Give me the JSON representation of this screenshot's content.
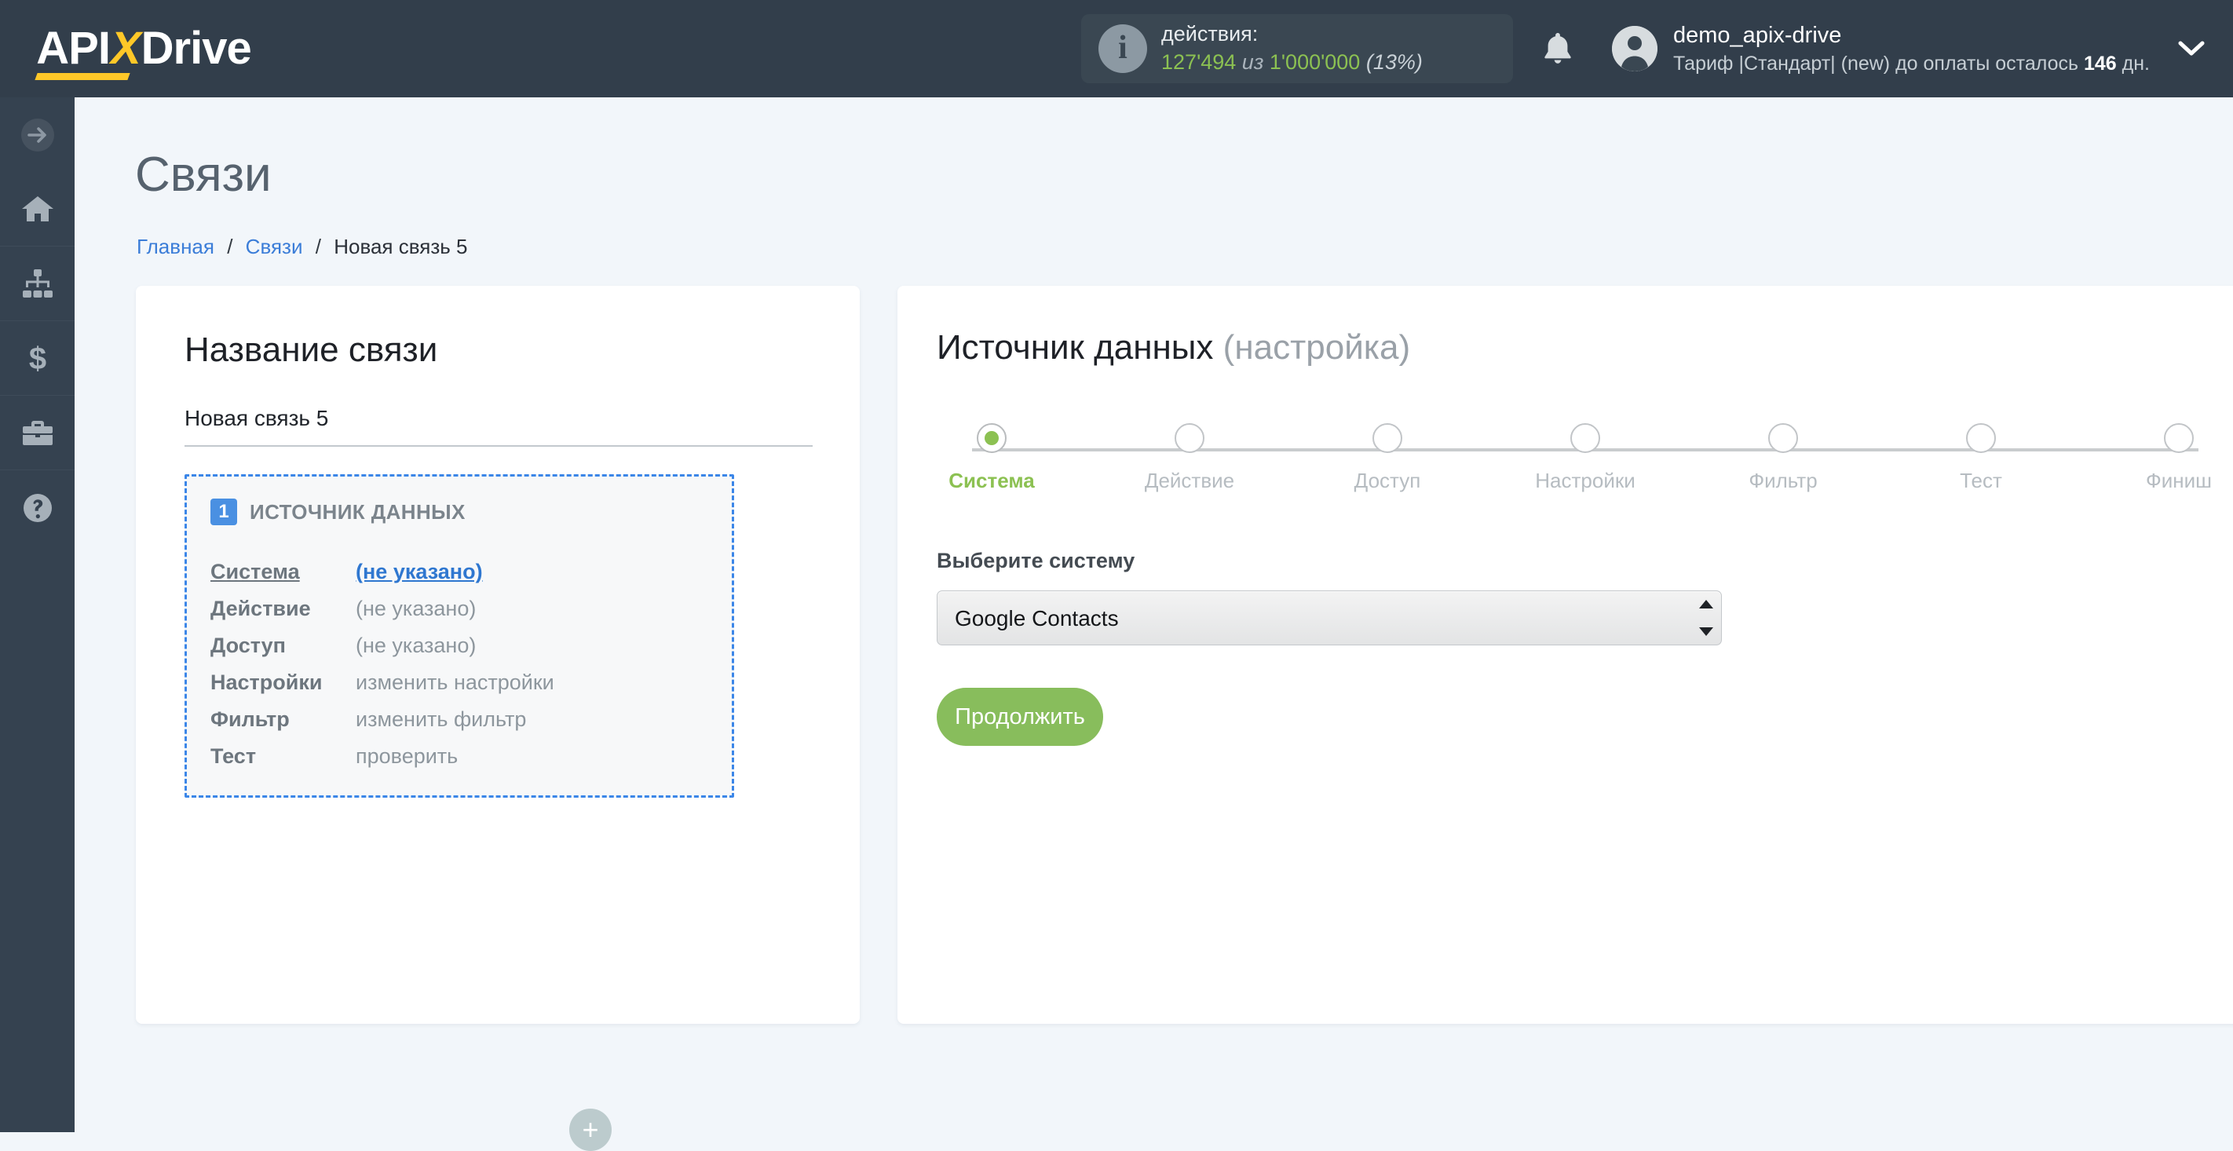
{
  "header": {
    "logo": {
      "part1": "API",
      "x": "X",
      "part2": "Drive"
    },
    "counter": {
      "icon": "info-icon",
      "label": "действия:",
      "used": "127'494",
      "separator": "из",
      "total": "1'000'000",
      "percent": "(13%)"
    },
    "notifications_icon": "bell-icon",
    "user": {
      "avatar": "user-avatar-icon",
      "name": "demo_apix-drive",
      "plan_prefix": "Тариф |Стандарт| (new) до оплаты осталось ",
      "plan_days": "146",
      "plan_suffix": " дн.",
      "chevron": "chevron-down-icon"
    }
  },
  "sidebar": {
    "items": [
      {
        "icon": "arrow-right-circle-icon",
        "name": "expand-menu"
      },
      {
        "icon": "home-icon",
        "name": "home"
      },
      {
        "icon": "sitemap-icon",
        "name": "connections"
      },
      {
        "icon": "dollar-icon",
        "name": "billing"
      },
      {
        "icon": "briefcase-icon",
        "name": "business"
      },
      {
        "icon": "question-circle-icon",
        "name": "help"
      }
    ]
  },
  "page": {
    "title": "Связи",
    "breadcrumb": {
      "items": [
        "Главная",
        "Связи",
        "Новая связь 5"
      ],
      "separator": "/"
    }
  },
  "left_card": {
    "title": "Название связи",
    "name_value": "Новая связь 5",
    "name_placeholder": "Название связи",
    "source_block": {
      "badge": "1",
      "heading": "ИСТОЧНИК ДАННЫХ",
      "rows": [
        {
          "key": "Система",
          "value": "(не указано)",
          "key_link": true,
          "value_link": true
        },
        {
          "key": "Действие",
          "value": "(не указано)",
          "key_link": false,
          "value_link": false
        },
        {
          "key": "Доступ",
          "value": "(не указано)",
          "key_link": false,
          "value_link": false
        },
        {
          "key": "Настройки",
          "value": "изменить настройки",
          "key_link": false,
          "value_link": false
        },
        {
          "key": "Фильтр",
          "value": "изменить фильтр",
          "key_link": false,
          "value_link": false
        },
        {
          "key": "Тест",
          "value": "проверить",
          "key_link": false,
          "value_link": false
        }
      ]
    },
    "add_button_label": "+"
  },
  "right_card": {
    "title_main": "Источник данных",
    "title_muted": "(настройка)",
    "steps": [
      {
        "label": "Система",
        "active": true
      },
      {
        "label": "Действие",
        "active": false
      },
      {
        "label": "Доступ",
        "active": false
      },
      {
        "label": "Настройки",
        "active": false
      },
      {
        "label": "Фильтр",
        "active": false
      },
      {
        "label": "Тест",
        "active": false
      },
      {
        "label": "Финиш",
        "active": false
      }
    ],
    "field_label": "Выберите систему",
    "system_selected": "Google Contacts",
    "system_options": [
      "Google Contacts"
    ],
    "continue_label": "Продолжить"
  },
  "colors": {
    "header_bg": "#323e4b",
    "sidebar_bg": "#354250",
    "page_bg": "#f2f6fa",
    "accent_green": "#8cc152",
    "accent_blue": "#3b86e8",
    "brand_yellow": "#ffc828",
    "button_green": "#88bd5c"
  }
}
